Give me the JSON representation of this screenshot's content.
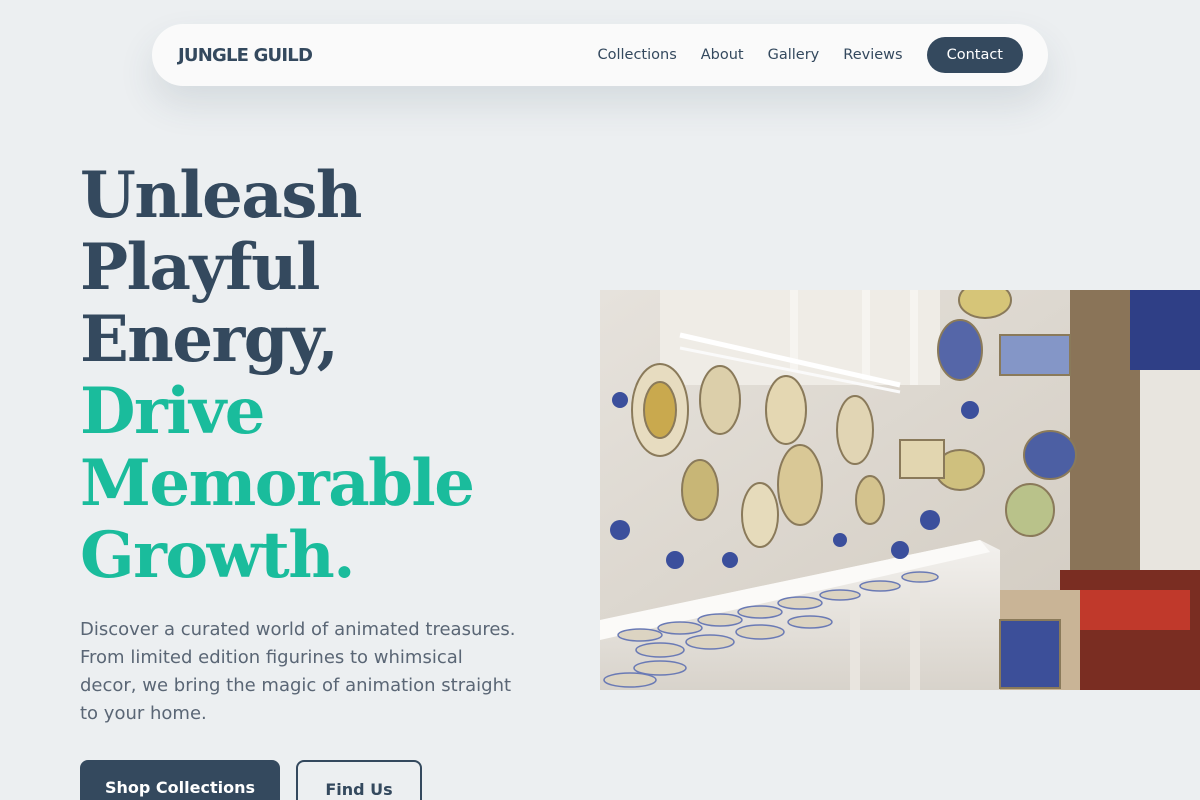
{
  "nav": {
    "brand": "JUNGLE GUILD",
    "links": [
      "Collections",
      "About",
      "Gallery",
      "Reviews"
    ],
    "cta": "Contact"
  },
  "hero": {
    "title_lines_dark": [
      "Unleash",
      "Playful",
      "Energy,"
    ],
    "title_lines_accent": [
      "Drive",
      "Memorable",
      "Growth."
    ],
    "description": "Discover a curated world of animated treasures. From limited edition figurines to whimsical decor, we bring the magic of animation straight to your home.",
    "primary_button": "Shop Collections",
    "secondary_button": "Find Us"
  },
  "colors": {
    "background": "#eceff1",
    "primary": "#34495e",
    "accent": "#1abc9c"
  }
}
